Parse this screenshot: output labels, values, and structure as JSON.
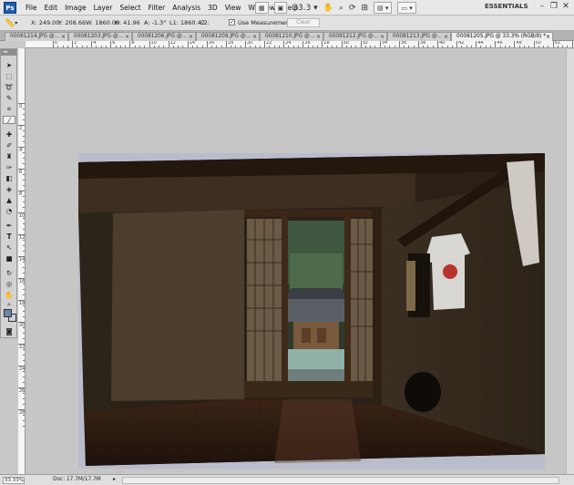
{
  "menubar": {
    "logo": "Ps",
    "menus": [
      "File",
      "Edit",
      "Image",
      "Layer",
      "Select",
      "Filter",
      "Analysis",
      "3D",
      "View",
      "Window",
      "Help"
    ],
    "zoom_value": "33.3",
    "workspace": "ESSENTIALS"
  },
  "options": {
    "x": "X: 249.00",
    "y": "Y: 208.66",
    "w": "W: 1860.00",
    "h": "H: 41.96",
    "a": "A: -1.3°",
    "l1": "L1: 1860.47",
    "l2": "L2:",
    "measure_label": "Use Measurement Scale",
    "clear_label": "Clear"
  },
  "tabs": [
    {
      "label": "00081214.JPG @..."
    },
    {
      "label": "00081203.JPG @..."
    },
    {
      "label": "00081206.JPG @..."
    },
    {
      "label": "00081209.JPG @..."
    },
    {
      "label": "00081210.JPG @..."
    },
    {
      "label": "00081212.JPG @..."
    },
    {
      "label": "00081213.JPG @..."
    },
    {
      "label": "00081205.JPG @ 33.3% (RGB/8) *",
      "active": true
    }
  ],
  "ruler_top_labels": [
    "0",
    "2",
    "4",
    "6",
    "8",
    "10",
    "12",
    "14",
    "16",
    "18",
    "20",
    "22",
    "24",
    "26",
    "28",
    "30",
    "32",
    "34",
    "36",
    "38",
    "40",
    "42",
    "44",
    "46",
    "48",
    "50",
    "52",
    "54",
    "56"
  ],
  "ruler_left_labels": [
    "0",
    "2",
    "4",
    "6",
    "8",
    "10",
    "12",
    "14",
    "16",
    "18",
    "20",
    "22",
    "24",
    "26",
    "28"
  ],
  "colors": {
    "foreground": "#6f84a9",
    "background": "#c9d3e3",
    "canvas_bg": "#c6c6c6",
    "doc_border": "#b9bccb"
  },
  "tools": [
    "move-icon",
    "marquee-icon",
    "lasso-icon",
    "quick-select-icon",
    "crop-icon",
    "ruler-icon",
    "healing-brush-icon",
    "brush-icon",
    "clone-stamp-icon",
    "history-brush-icon",
    "eraser-icon",
    "paint-bucket-icon",
    "blur-icon",
    "dodge-icon",
    "pen-icon",
    "type-icon",
    "path-select-icon",
    "rectangle-icon",
    "3d-rotate-icon",
    "3d-orbit-icon",
    "hand-icon",
    "zoom-icon"
  ],
  "status": {
    "zoom": "33.33%",
    "doc": "Doc: 17.7M/17.7M"
  }
}
